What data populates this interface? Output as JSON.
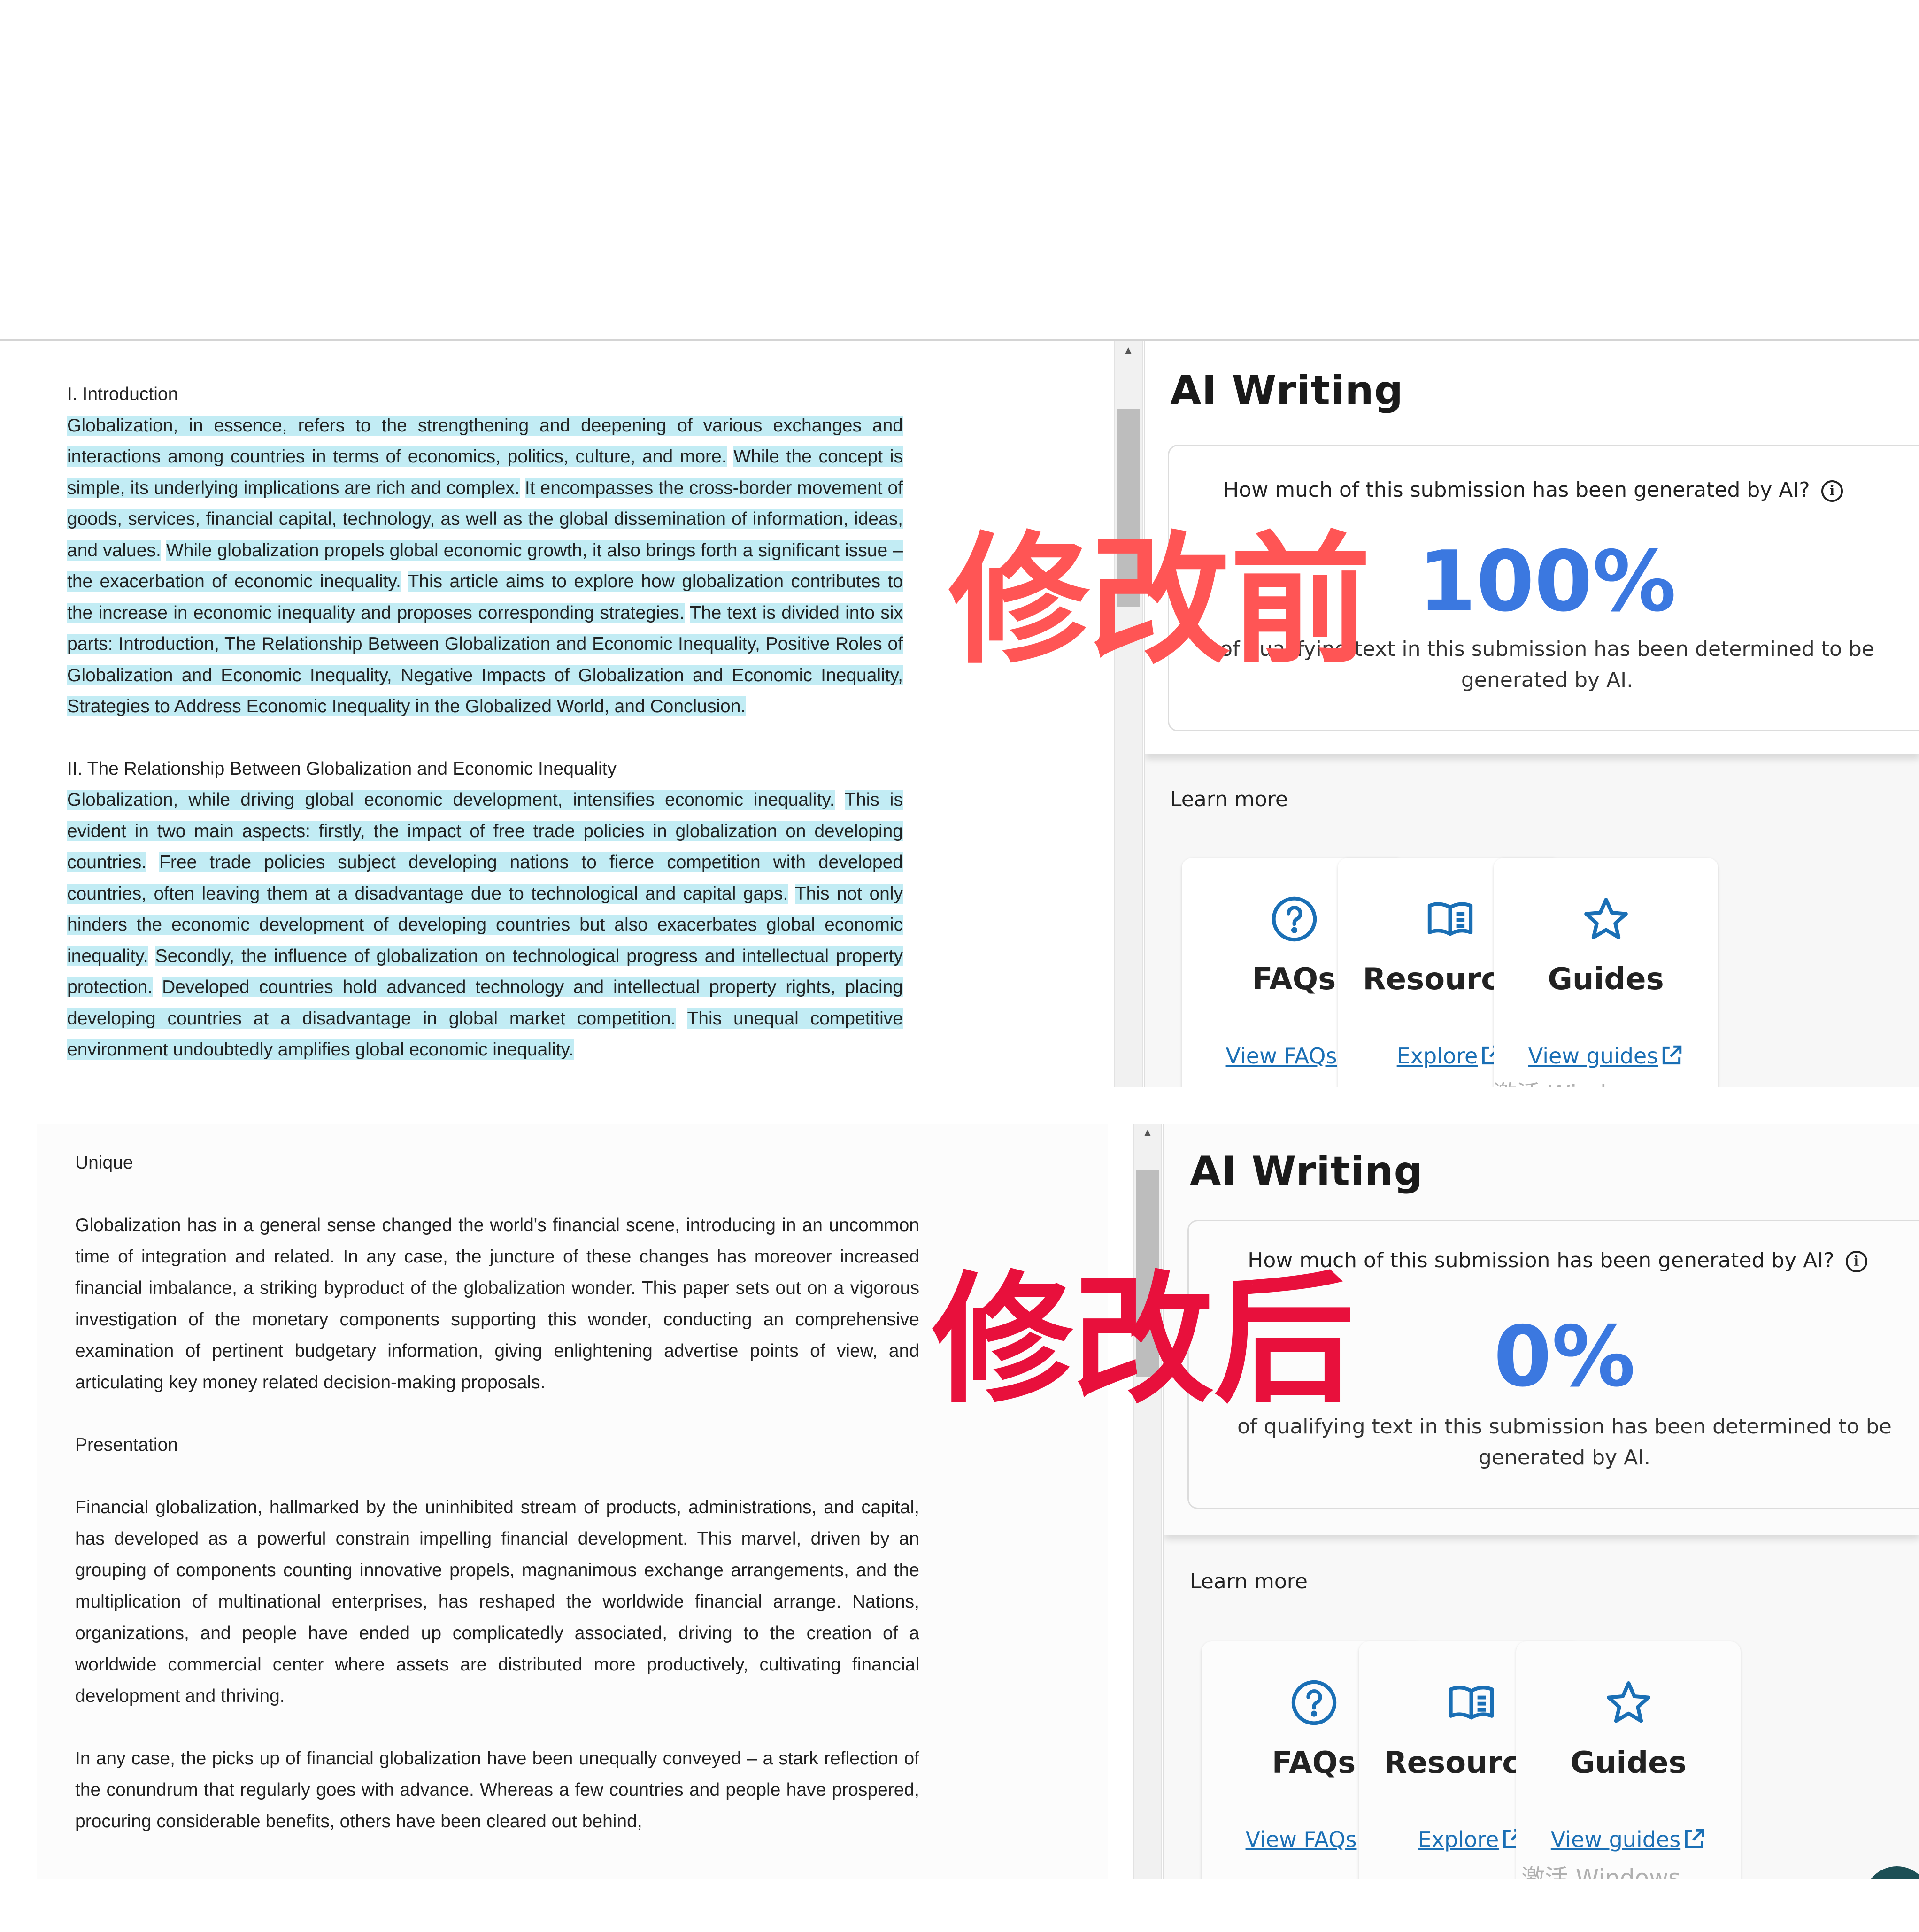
{
  "overlay_labels": {
    "before": "修改前",
    "after": "修改后"
  },
  "before": {
    "document": {
      "sections": [
        {
          "heading": "I. Introduction",
          "sentences": [
            "Globalization, in essence, refers to the strengthening and deepening of various exchanges and interactions among countries in terms of economics, politics, culture, and more.",
            "While the concept is simple, its underlying implications are rich and complex.",
            "It encompasses the cross-border movement of goods, services, financial capital, technology, as well as the global dissemination of information, ideas, and values.",
            "While globalization propels global economic growth, it also brings forth a significant issue  –  the exacerbation of economic inequality.",
            "This article aims to explore how globalization contributes to the increase in economic inequality and proposes corresponding strategies.",
            "The text is divided into six parts: Introduction, The Relationship Between Globalization and Economic Inequality, Positive Roles of Globalization and Economic Inequality, Negative Impacts of Globalization and Economic Inequality, Strategies to Address Economic Inequality in the Globalized World, and Conclusion."
          ]
        },
        {
          "heading": "II. The Relationship Between Globalization and Economic Inequality",
          "sentences": [
            "Globalization, while driving global economic development, intensifies economic inequality.",
            "This is evident in two main aspects: firstly, the impact of free trade policies in globalization on developing countries.",
            "Free trade policies subject developing nations to fierce competition with developed countries, often leaving them at a disadvantage due to technological and capital gaps.",
            "This not only hinders the economic development of developing countries but also exacerbates global economic inequality.",
            "Secondly, the influence of globalization on technological progress and intellectual property protection.",
            "Developed countries hold advanced technology and intellectual property rights, placing developing countries at a disadvantage in global market competition.",
            "This unequal competitive environment undoubtedly amplifies global economic inequality."
          ]
        }
      ]
    },
    "ai_panel": {
      "title": "AI Writing",
      "question": "How much of this submission has been generated by AI?",
      "percent": "100%",
      "percent_value": 100,
      "description": "of qualifying text in this submission has been determined to be generated by AI.",
      "learn_more": "Learn more",
      "cards": [
        {
          "icon": "question-circle-icon",
          "title": "FAQs",
          "link": "View FAQs"
        },
        {
          "icon": "open-book-icon",
          "title": "Resources",
          "link": "Explore"
        },
        {
          "icon": "star-icon",
          "title": "Guides",
          "link": "View guides"
        }
      ],
      "watermark": "激活 Windows"
    }
  },
  "after": {
    "document": {
      "paragraphs": [
        {
          "type": "heading",
          "text": "Unique"
        },
        {
          "type": "body",
          "text": "Globalization has in a general sense changed the world's financial scene, introducing in an uncommon time of integration and related. In any case, the juncture of these changes has moreover increased financial imbalance, a striking byproduct of the globalization wonder. This paper sets out on a vigorous investigation of the monetary components supporting this wonder, conducting an comprehensive examination of pertinent budgetary information, giving enlightening advertise points of view, and articulating key money related decision-making proposals."
        },
        {
          "type": "heading",
          "text": "Presentation"
        },
        {
          "type": "body",
          "text": "Financial globalization, hallmarked by the uninhibited stream of products, administrations, and capital, has developed as a powerful constrain impelling financial development. This marvel, driven by an grouping of components counting innovative propels, magnanimous exchange arrangements, and the multiplication of multinational enterprises, has reshaped the worldwide financial arrange. Nations, organizations, and people have ended up complicatedly associated, driving to the creation of a worldwide commercial center where assets are distributed more productively, cultivating financial development and thriving."
        },
        {
          "type": "body",
          "text": "In any case, the picks up of financial globalization have been unequally conveyed  –  a stark reflection of the conundrum that regularly goes with advance. Whereas a few countries and people have prospered, procuring considerable benefits, others have been cleared out behind,"
        }
      ]
    },
    "ai_panel": {
      "title": "AI Writing",
      "question": "How much of this submission has been generated by AI?",
      "percent": "0%",
      "percent_value": 0,
      "description": "of qualifying text in this submission has been determined to be generated by AI.",
      "learn_more": "Learn more",
      "cards": [
        {
          "icon": "question-circle-icon",
          "title": "FAQs",
          "link": "View FAQs"
        },
        {
          "icon": "open-book-icon",
          "title": "Resources",
          "link": "Explore"
        },
        {
          "icon": "star-icon",
          "title": "Guides",
          "link": "View guides"
        }
      ],
      "watermark": "激活 Windows"
    }
  },
  "colors": {
    "highlight": "#c2ecf4",
    "percent": "#3b78e0",
    "link": "#1a6fb5",
    "label_before": "#ff5555",
    "label_after": "#e8103c"
  }
}
